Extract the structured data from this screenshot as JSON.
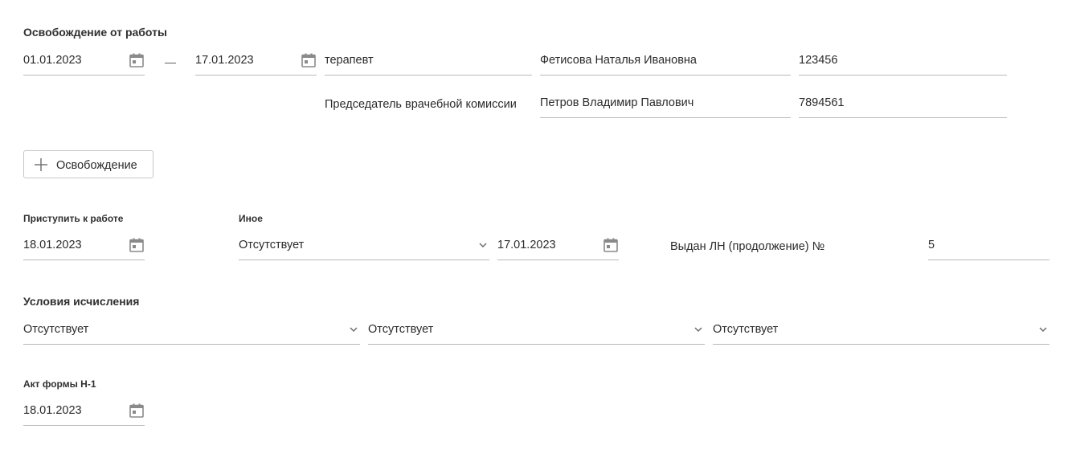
{
  "release": {
    "title": "Освобождение от работы",
    "date_from": "01.01.2023",
    "dash": "—",
    "date_to": "17.01.2023",
    "specialty": "терапевт",
    "doctor_name": "Фетисова Наталья Ивановна",
    "doctor_id": "123456",
    "commission_label": "Председатель врачебной комиссии",
    "commission_name": "Петров Владимир Павлович",
    "commission_id": "7894561",
    "add_button_label": "Освобождение"
  },
  "return_to_work": {
    "title": "Приступить к работе",
    "date": "18.01.2023"
  },
  "other": {
    "title": "Иное",
    "select_value": "Отсутствует",
    "date": "17.01.2023",
    "ln_label": "Выдан ЛН (продолжение) №",
    "ln_number": "5"
  },
  "calc_conditions": {
    "title": "Условия исчисления",
    "select_1": "Отсутствует",
    "select_2": "Отсутствует",
    "select_3": "Отсутствует"
  },
  "act_n1": {
    "title": "Акт формы Н-1",
    "date": "18.01.2023"
  },
  "colors": {
    "text": "#2b2b2b",
    "underline": "#b9b9b9",
    "icon": "#8a8a8a"
  },
  "icons": {
    "date_picker": "calendar-icon",
    "dropdown": "chevron-down-icon",
    "add": "plus-icon"
  }
}
